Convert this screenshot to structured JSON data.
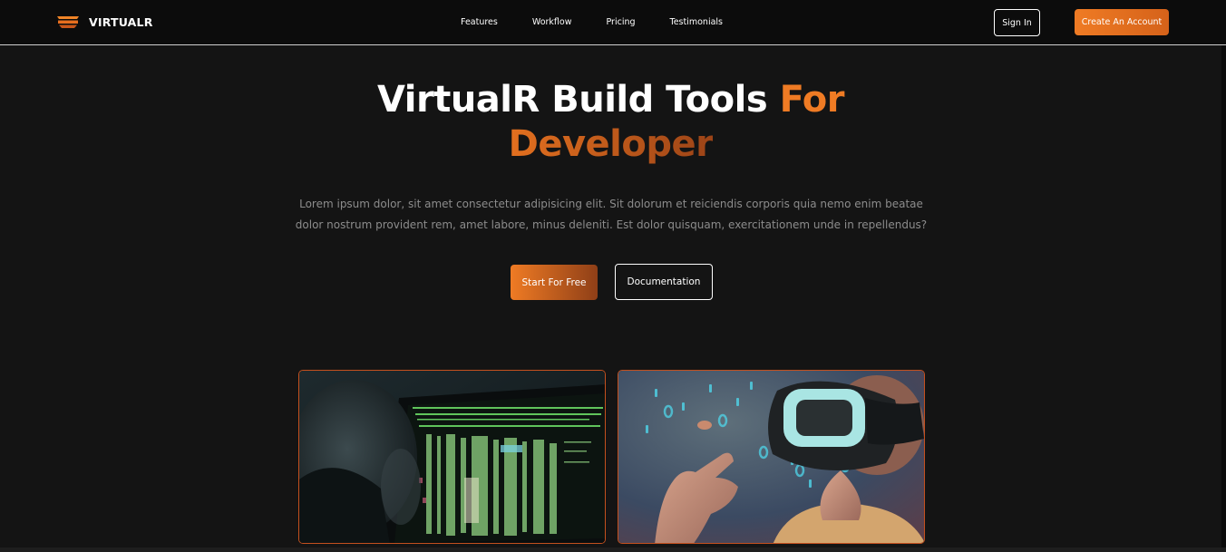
{
  "nav": {
    "brand": "VIRTUALR",
    "logo_icon": "vr-headset-logo-icon",
    "links": [
      "Features",
      "Workflow",
      "Pricing",
      "Testimonials"
    ],
    "signin_label": "Sign In",
    "create_label": "Create An Account"
  },
  "hero": {
    "title_main": "VirtualR Build Tools ",
    "title_accent_1": "For",
    "title_accent_2": "Developer",
    "description": "Lorem ipsum dolor, sit amet consectetur adipisicing elit. Sit dolorum et reiciendis corporis quia nemo enim beatae dolor nostrum provident rem, amet labore, minus deleniti. Est dolor quisquam, exercitationem unde in repellendus?",
    "cta_primary": "Start For Free",
    "cta_secondary": "Documentation"
  },
  "media": [
    {
      "name": "developer-code-screen-image"
    },
    {
      "name": "vr-headset-person-image"
    }
  ],
  "colors": {
    "accent": "#ef7b24",
    "accent_dark": "#8f3f17",
    "background": "#141414",
    "navbar": "#0c0c0c"
  }
}
